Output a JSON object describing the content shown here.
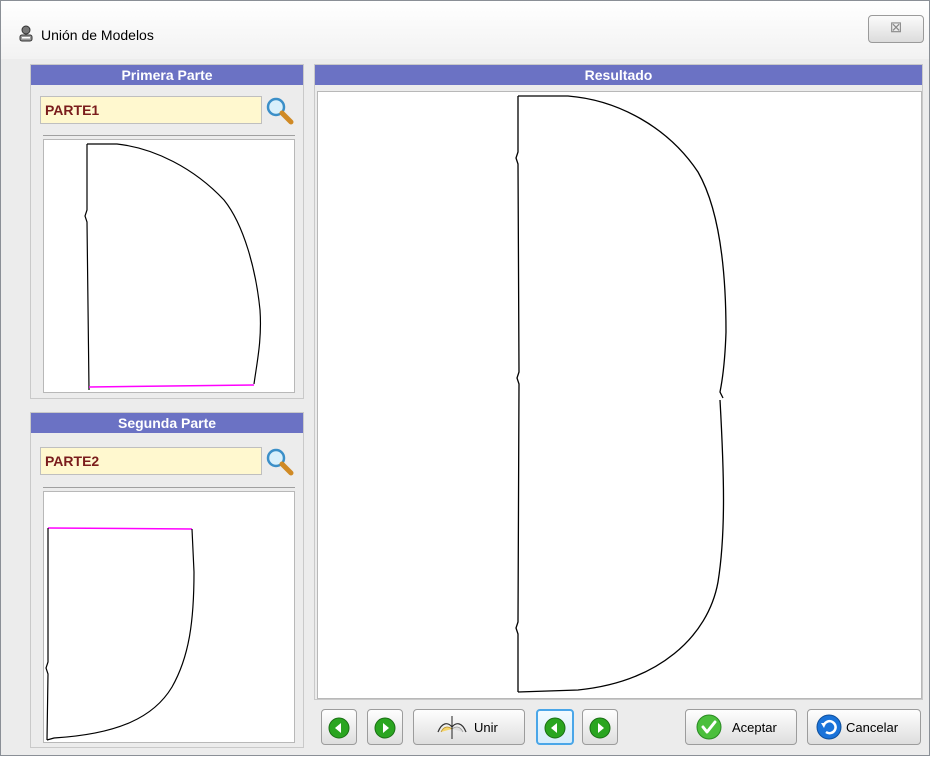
{
  "window": {
    "title": "Unión de Modelos",
    "close_glyph": "⊠",
    "title_icon": "user-group-icon"
  },
  "primera": {
    "header": "Primera Parte",
    "field_value": "PARTE1",
    "search_icon": "magnifier-icon"
  },
  "segunda": {
    "header": "Segunda Parte",
    "field_value": "PARTE2",
    "search_icon": "magnifier-icon"
  },
  "resultado": {
    "header": "Resultado"
  },
  "toolbar": {
    "prev_icon": "arrow-left-circle-icon",
    "next_icon": "arrow-right-circle-icon",
    "unir_label": "Unir",
    "unir_icon": "join-icon",
    "aceptar_label": "Aceptar",
    "aceptar_icon": "check-circle-icon",
    "cancelar_label": "Cancelar",
    "cancelar_icon": "undo-circle-icon"
  },
  "colors": {
    "header_bg": "#6b72c4",
    "field_bg": "#fff8cf",
    "field_text": "#7a1c1c",
    "seam": "#ff00ff",
    "green": "#2aa520",
    "blue": "#1a73d9"
  }
}
